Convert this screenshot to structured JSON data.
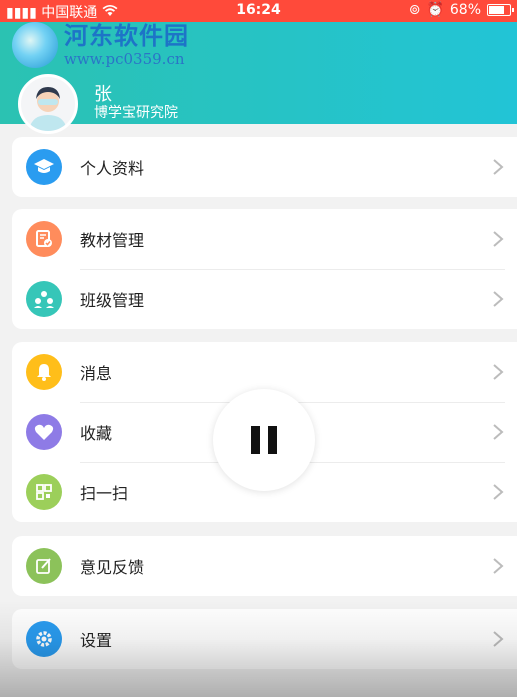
{
  "status_bar": {
    "carrier": "中国联通",
    "time": "16:24",
    "battery": "68%",
    "battery_level": 0.68
  },
  "watermark": {
    "title": "河东软件园",
    "url": "www.pc0359.cn"
  },
  "profile": {
    "name": "张",
    "org": "博学宝研究院"
  },
  "colors": {
    "header_start": "#2bc2b2",
    "header_end": "#22c4d6",
    "status_bar": "#ff4a3a"
  },
  "groups": [
    {
      "items": [
        {
          "label": "个人资料",
          "icon": "graduation-cap-icon",
          "color": "#2a9cf0"
        }
      ]
    },
    {
      "items": [
        {
          "label": "教材管理",
          "icon": "textbook-icon",
          "color": "#ff8c5c"
        },
        {
          "label": "班级管理",
          "icon": "class-group-icon",
          "color": "#36c6b8"
        }
      ]
    },
    {
      "items": [
        {
          "label": "消息",
          "icon": "bell-icon",
          "color": "#ffbe1a"
        },
        {
          "label": "收藏",
          "icon": "heart-icon",
          "color": "#8e7be6"
        },
        {
          "label": "扫一扫",
          "icon": "scan-icon",
          "color": "#9ccf5a"
        }
      ]
    },
    {
      "items": [
        {
          "label": "意见反馈",
          "icon": "feedback-icon",
          "color": "#8cc25a"
        }
      ]
    },
    {
      "items": [
        {
          "label": "设置",
          "icon": "gear-icon",
          "color": "#2a9cf0"
        }
      ]
    }
  ],
  "overlay": {
    "icon": "pause-icon"
  }
}
